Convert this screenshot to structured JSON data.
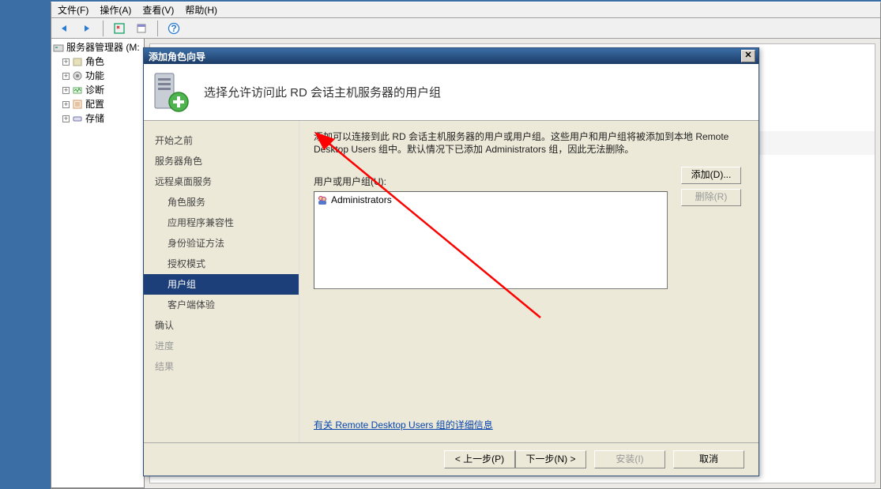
{
  "menubar": {
    "file": "文件(F)",
    "action": "操作(A)",
    "view": "查看(V)",
    "help": "帮助(H)"
  },
  "tree": {
    "root": "服务器管理器 (M:",
    "nodes": [
      "角色",
      "功能",
      "诊断",
      "配置",
      "存储"
    ]
  },
  "wizard": {
    "title": "添加角色向导",
    "heading": "选择允许访问此 RD 会话主机服务器的用户组",
    "nav": {
      "before": "开始之前",
      "server_roles": "服务器角色",
      "rds": "远程桌面服务",
      "role_service": "角色服务",
      "app_compat": "应用程序兼容性",
      "auth_method": "身份验证方法",
      "license_mode": "授权模式",
      "user_groups": "用户组",
      "client_exp": "客户端体验",
      "confirm": "确认",
      "progress": "进度",
      "result": "结果"
    },
    "desc": "添加可以连接到此 RD 会话主机服务器的用户或用户组。这些用户和用户组将被添加到本地 Remote Desktop Users 组中。默认情况下已添加 Administrators 组，因此无法删除。",
    "list_label": "用户或用户组(U):",
    "list_items": [
      "Administrators"
    ],
    "buttons": {
      "add": "添加(D)...",
      "remove": "删除(R)"
    },
    "link": "有关 Remote Desktop Users 组的详细信息",
    "footer": {
      "prev": "< 上一步(P)",
      "next": "下一步(N) >",
      "install": "安装(I)",
      "cancel": "取消"
    }
  }
}
